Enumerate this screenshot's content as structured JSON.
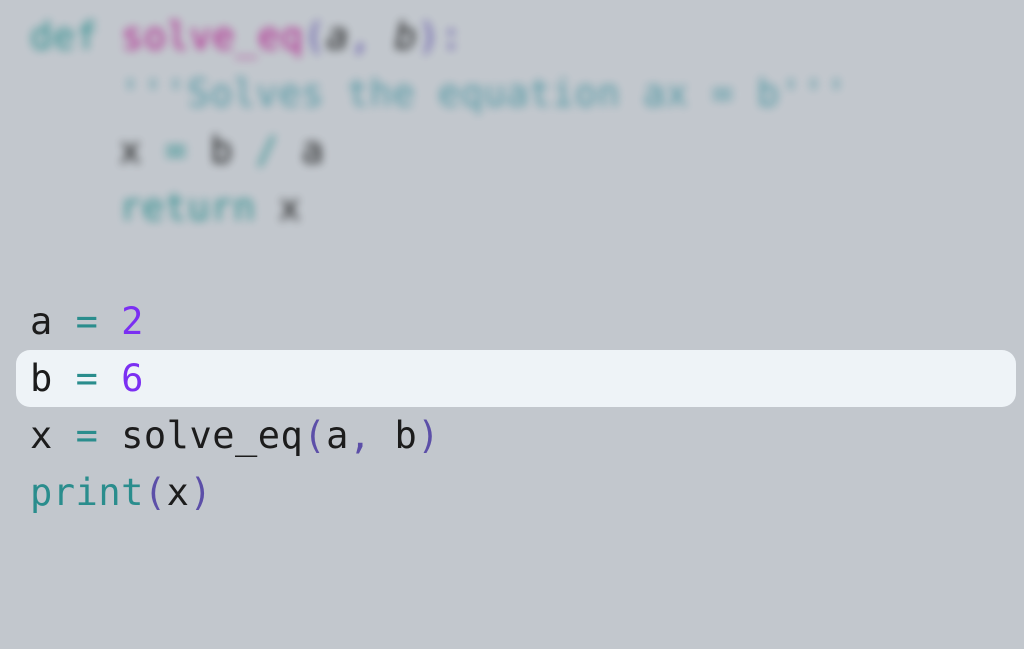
{
  "code": {
    "l1": {
      "def": "def ",
      "fn": "solve_eq",
      "lp": "(",
      "a": "a",
      "c1": ", ",
      "b": "b",
      "rp": ")",
      "colon": ":"
    },
    "l2": {
      "doc": "'''Solves the equation ax = b'''"
    },
    "l3": {
      "x": "x ",
      "eq": "=",
      "sp1": " ",
      "b": "b ",
      "div": "/",
      "sp2": " ",
      "a": "a"
    },
    "l4": {
      "ret": "return ",
      "x": "x"
    },
    "l6": {
      "a": "a ",
      "eq": "=",
      "sp": " ",
      "val": "2"
    },
    "l7": {
      "b": "b ",
      "eq": "=",
      "sp": " ",
      "val": "6"
    },
    "l8": {
      "x": "x ",
      "eq": "=",
      "sp": " ",
      "fn": "solve_eq",
      "lp": "(",
      "a": "a",
      "c": ", ",
      "b": "b",
      "rp": ")"
    },
    "l9": {
      "pr": "print",
      "lp": "(",
      "x": "x",
      "rp": ")"
    }
  }
}
